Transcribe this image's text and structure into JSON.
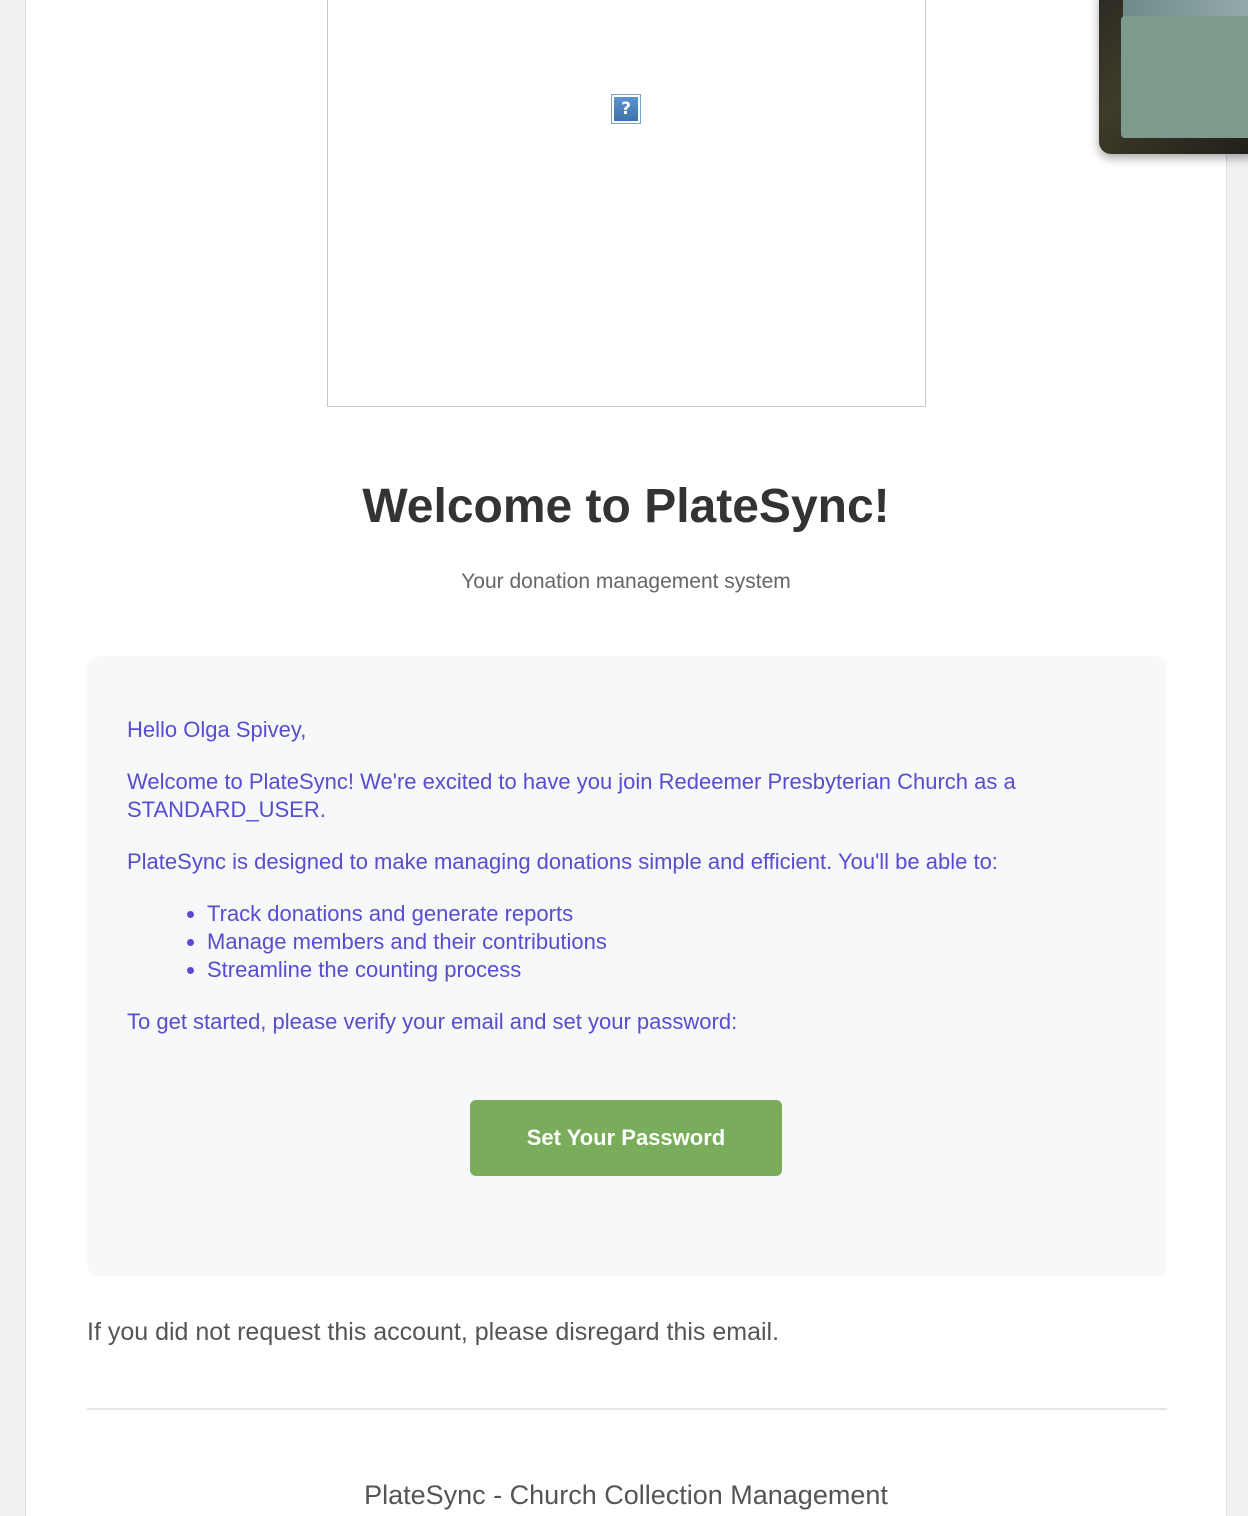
{
  "email": {
    "logo": {
      "broken_image_glyph": "?"
    },
    "title": "Welcome to PlateSync!",
    "subtitle": "Your donation management system",
    "card": {
      "greeting": "Hello Olga Spivey,",
      "welcome": "Welcome to PlateSync! We're excited to have you join Redeemer Presbyterian Church as a STANDARD_USER.",
      "intro": "PlateSync is designed to make managing donations simple and efficient. You'll be able to:",
      "features": [
        "Track donations and generate reports",
        "Manage members and their contributions",
        "Streamline the counting process"
      ],
      "instructions": "To get started, please verify your email and set your password:",
      "button_label": "Set Your Password"
    },
    "disclaimer": "If you did not request this account, please disregard this email.",
    "footer": "PlateSync - Church Collection Management"
  },
  "colors": {
    "accent_text": "#5a4bd1",
    "button": "#79ad5b",
    "title": "#333333"
  }
}
